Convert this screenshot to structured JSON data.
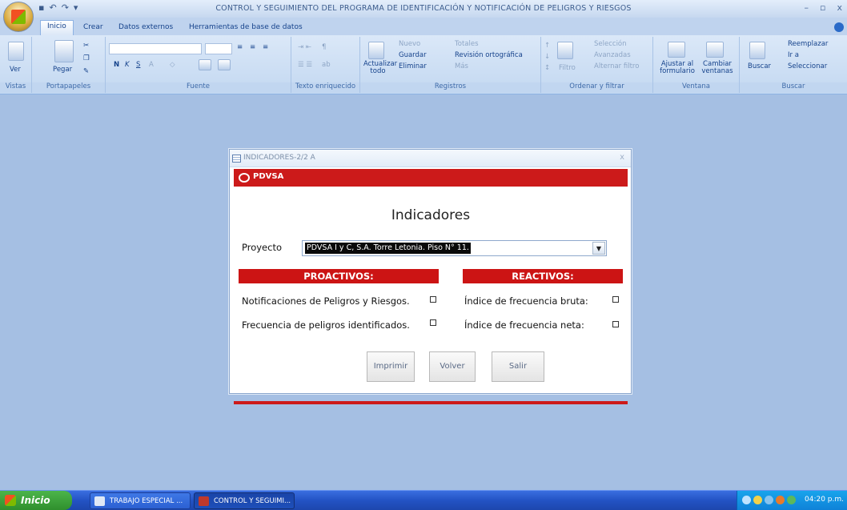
{
  "window": {
    "title": "CONTROL Y SEGUIMIENTO DEL PROGRAMA DE IDENTIFICACIÓN Y NOTIFICACIÓN DE PELIGROS Y RIESGOS",
    "minimize": "–",
    "restore": "▫",
    "close": "x"
  },
  "tabs": [
    "Inicio",
    "Crear",
    "Datos externos",
    "Herramientas de base de datos"
  ],
  "ribbon": {
    "vistas": {
      "ver": "Ver",
      "label": "Vistas"
    },
    "portapapeles": {
      "pegar": "Pegar",
      "label": "Portapapeles"
    },
    "fuente": {
      "bold": "N",
      "italic": "K",
      "underline": "S",
      "label": "Fuente"
    },
    "texto": {
      "label": "Texto enriquecido"
    },
    "registros": {
      "actualizar": "Actualizar todo",
      "nuevo": "Nuevo",
      "guardar": "Guardar",
      "eliminar": "Eliminar",
      "totales": "Totales",
      "revision": "Revisión ortográfica",
      "mas": "Más",
      "label": "Registros"
    },
    "ordenar": {
      "filtro": "Filtro",
      "seleccion": "Selección",
      "avanzadas": "Avanzadas",
      "alternar": "Alternar filtro",
      "label": "Ordenar y filtrar"
    },
    "ventana": {
      "ajustar": "Ajustar al formulario",
      "cambiar": "Cambiar ventanas",
      "label": "Ventana"
    },
    "buscar": {
      "buscar": "Buscar",
      "reemplazar": "Reemplazar",
      "ira": "Ir a",
      "seleccionar": "Seleccionar",
      "label": "Buscar"
    }
  },
  "dialog": {
    "title": "INDICADORES-2/2 A",
    "close": "x",
    "brand": "PDVSA",
    "heading": "Indicadores",
    "proyecto_label": "Proyecto",
    "proyecto_value": "PDVSA I y C, S.A. Torre Letonia. Piso N° 11.",
    "proactivos": {
      "header": "PROACTIVOS:",
      "items": [
        "Notificaciones de Peligros y Riesgos.",
        "Frecuencia de peligros identificados."
      ]
    },
    "reactivos": {
      "header": "REACTIVOS:",
      "items": [
        "Índice de frecuencia bruta:",
        "Índice de frecuencia neta:"
      ]
    },
    "buttons": {
      "imprimir": "Imprimir",
      "volver": "Volver",
      "salir": "Salir"
    }
  },
  "taskbar": {
    "start": "Inicio",
    "tasks": [
      "TRABAJO ESPECIAL ...",
      "CONTROL Y SEGUIMI..."
    ],
    "clock": "04:20 p.m."
  },
  "colors": {
    "accent_red": "#cc1414",
    "workspace": "#a5bfe3"
  }
}
